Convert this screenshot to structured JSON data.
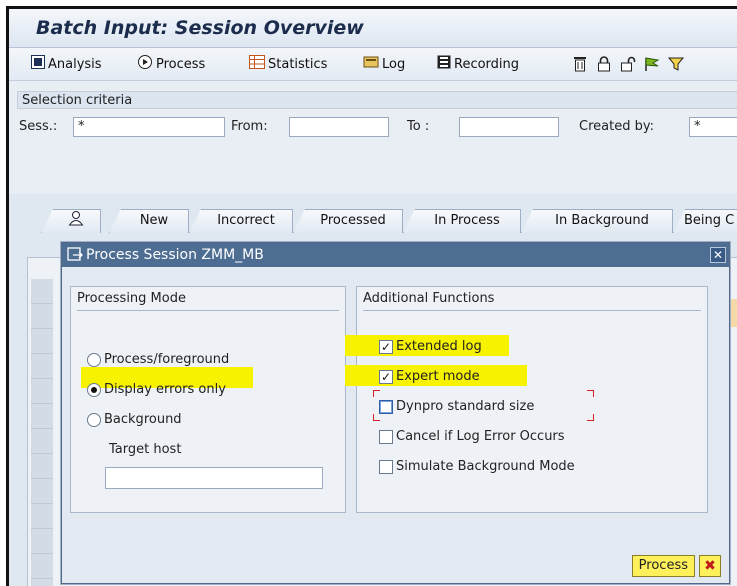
{
  "window": {
    "title": "Batch Input: Session Overview"
  },
  "toolbar": {
    "analysis": "Analysis",
    "process": "Process",
    "statistics": "Statistics",
    "log": "Log",
    "recording": "Recording",
    "icons": [
      "trash-icon",
      "lock-icon",
      "unlock-icon",
      "flag-icon",
      "filter-icon"
    ]
  },
  "selection": {
    "header": "Selection criteria",
    "session_label": "Sess.:",
    "session_value": "*",
    "from_label": "From:",
    "from_value": "",
    "to_label": "To :",
    "to_value": "",
    "created_by_label": "Created by:",
    "created_by_value": "*"
  },
  "tabs": [
    "New",
    "Incorrect",
    "Processed",
    "In Process",
    "In Background",
    "Being C"
  ],
  "dialog": {
    "title": "Process Session ZMM_MB",
    "processing_mode": {
      "header": "Processing Mode",
      "options": [
        "Process/foreground",
        "Display errors only",
        "Background"
      ],
      "selected": "Display errors only",
      "target_host_label": "Target host",
      "target_host_value": ""
    },
    "additional_functions": {
      "header": "Additional Functions",
      "options": [
        {
          "label": "Extended log",
          "checked": true
        },
        {
          "label": "Expert mode",
          "checked": true
        },
        {
          "label": "Dynpro standard size",
          "checked": false
        },
        {
          "label": "Cancel if Log Error Occurs",
          "checked": false
        },
        {
          "label": "Simulate Background Mode",
          "checked": false
        }
      ]
    },
    "process_button": "Process"
  },
  "colors": {
    "highlight": "#f6f200",
    "dialog_title": "#4e6d93",
    "button": "#fdf05a"
  }
}
